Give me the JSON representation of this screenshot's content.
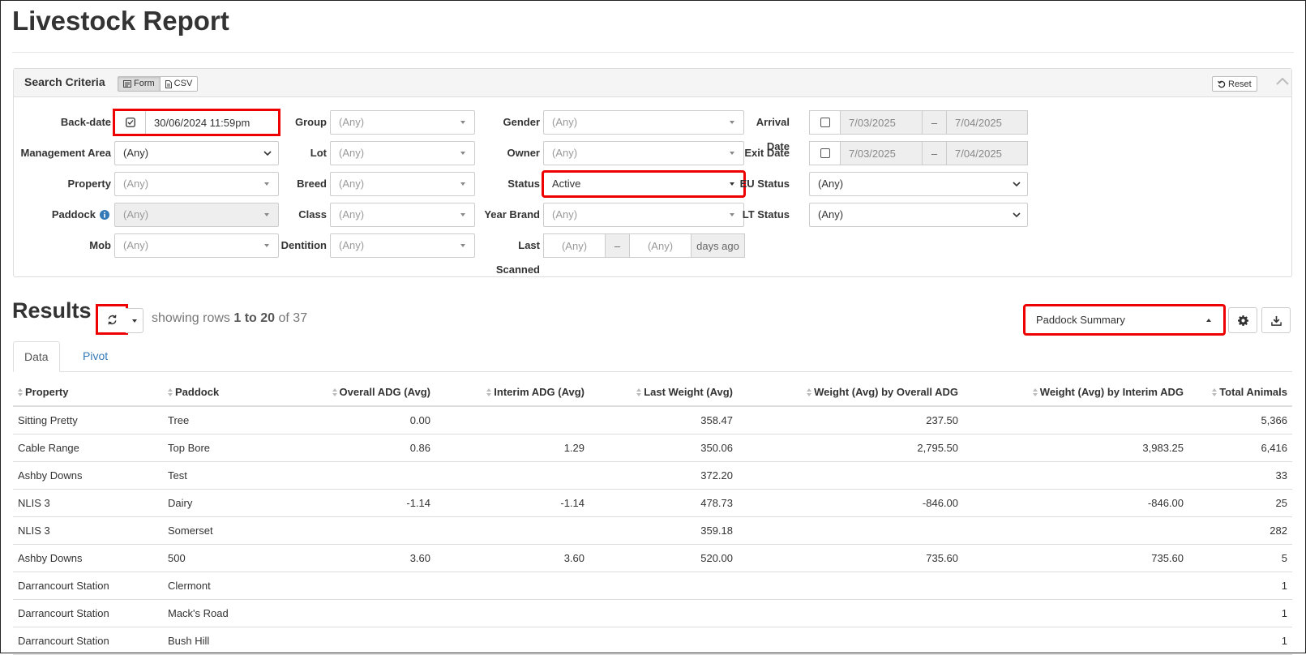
{
  "page": {
    "title": "Livestock Report"
  },
  "search": {
    "title": "Search Criteria",
    "form_label": "Form",
    "csv_label": "CSV",
    "reset_label": "Reset",
    "labels": {
      "backdate": "Back-date",
      "management_area": "Management Area",
      "property": "Property",
      "paddock": "Paddock",
      "mob": "Mob",
      "group": "Group",
      "lot": "Lot",
      "breed": "Breed",
      "class": "Class",
      "dentition": "Dentition",
      "gender": "Gender",
      "owner": "Owner",
      "status": "Status",
      "year_brand": "Year Brand",
      "last_scanned": "Last Scanned",
      "arrival_date": "Arrival Date",
      "exit_date": "Exit Date",
      "eu_status": "EU Status",
      "lt_status": "LT Status"
    },
    "values": {
      "backdate": "30/06/2024 11:59pm",
      "any": "(Any)",
      "status": "Active",
      "arrival_from": "7/03/2025",
      "arrival_to": "7/04/2025",
      "exit_from": "7/03/2025",
      "exit_to": "7/04/2025",
      "range_sep": "–",
      "days_ago": "days ago"
    }
  },
  "results": {
    "title": "Results",
    "rows_prefix": "showing rows ",
    "rows_range": "1 to 20",
    "rows_of": " of 37",
    "report_selected": "Paddock Summary",
    "tabs": [
      "Data",
      "Pivot"
    ],
    "columns": [
      "Property",
      "Paddock",
      "Overall ADG (Avg)",
      "Interim ADG (Avg)",
      "Last Weight (Avg)",
      "Weight (Avg) by Overall ADG",
      "Weight (Avg) by Interim ADG",
      "Total Animals"
    ],
    "rows": [
      [
        "Sitting Pretty",
        "Tree",
        "0.00",
        "",
        "358.47",
        "237.50",
        "",
        "5,366"
      ],
      [
        "Cable Range",
        "Top Bore",
        "0.86",
        "1.29",
        "350.06",
        "2,795.50",
        "3,983.25",
        "6,416"
      ],
      [
        "Ashby Downs",
        "Test",
        "",
        "",
        "372.20",
        "",
        "",
        "33"
      ],
      [
        "NLIS 3",
        "Dairy",
        "-1.14",
        "-1.14",
        "478.73",
        "-846.00",
        "-846.00",
        "25"
      ],
      [
        "NLIS 3",
        "Somerset",
        "",
        "",
        "359.18",
        "",
        "",
        "282"
      ],
      [
        "Ashby Downs",
        "500",
        "3.60",
        "3.60",
        "520.00",
        "735.60",
        "735.60",
        "5"
      ],
      [
        "Darrancourt Station",
        "Clermont",
        "",
        "",
        "",
        "",
        "",
        "1"
      ],
      [
        "Darrancourt Station",
        "Mack's Road",
        "",
        "",
        "",
        "",
        "",
        "1"
      ],
      [
        "Darrancourt Station",
        "Bush Hill",
        "",
        "",
        "",
        "",
        "",
        "1"
      ]
    ]
  }
}
